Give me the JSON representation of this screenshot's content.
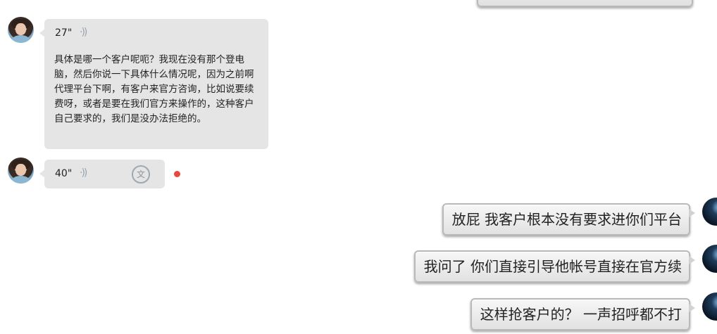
{
  "chat": {
    "incoming": [
      {
        "duration": "27\"",
        "wave_icon": "voice-wave-icon",
        "transcript": "具体是哪一个客户呢呃？我现在没有那个登电脑，然后你说一下具体什么情况呢，因为之前啊代理平台下啊，有客户来官方咨询，比如说要续费呀，或者是要在我们官方来操作的，这种客户自己要求的，我们是没办法拒绝的。"
      },
      {
        "duration": "40\"",
        "wave_icon": "voice-wave-icon",
        "translate_icon_glyph": "文",
        "unread_color": "#e8493c"
      }
    ],
    "outgoing": [
      {
        "text": "放屁 我客户根本没有要求进你们平台"
      },
      {
        "text": "我问了 你们直接引导他帐号直接在官方续"
      },
      {
        "text": "这样抢客户的？ 一声招呼都不打"
      }
    ]
  }
}
